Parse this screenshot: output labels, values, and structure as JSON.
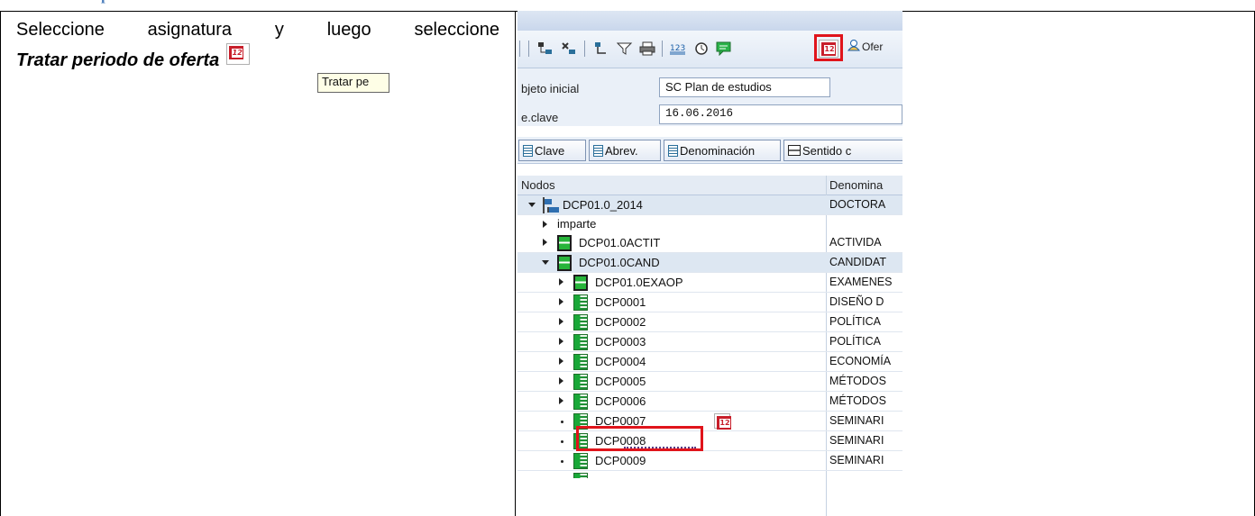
{
  "document": {
    "heading_fragment": "p",
    "instruction_line1_words": [
      "Seleccione",
      "asignatura",
      "y",
      "luego",
      "seleccione"
    ],
    "instruction_line2": "Tratar periodo de oferta",
    "instruction_icon": "offer-period-calendar-icon"
  },
  "sap": {
    "toolbar": {
      "icons": [
        "expand-icon",
        "collapse-icon",
        "filter-icon",
        "funnel-icon",
        "print-icon",
        "numbering-icon",
        "timer-icon",
        "comment-icon",
        "offer-period-calendar-icon",
        "person-icon"
      ],
      "ofer_label": "Ofer",
      "highlighted": "offer-period-calendar-icon"
    },
    "tooltip": "Tratar pe",
    "form": {
      "objeto_label": "bjeto inicial",
      "objeto_value": "SC Plan de estudios",
      "fecha_label": "e.clave",
      "fecha_value": "16.06.2016"
    },
    "buttons": [
      "Clave",
      "Abrev.",
      "Denominación",
      "Sentido c"
    ],
    "tree": {
      "col_nodes": "Nodos",
      "col_denom": "Denomina",
      "rows": [
        {
          "toggle": "down",
          "icon": "root",
          "label": "DCP01.0_2014",
          "denom": "DOCTORA"
        },
        {
          "toggle": "right",
          "icon": "",
          "label": "imparte",
          "denom": ""
        },
        {
          "toggle": "right",
          "icon": "mod",
          "label": "DCP01.0ACTIT",
          "denom": "ACTIVIDA"
        },
        {
          "toggle": "down",
          "icon": "mod",
          "label": "DCP01.0CAND",
          "denom": "CANDIDAT"
        },
        {
          "toggle": "right",
          "icon": "mod",
          "label": "DCP01.0EXAOP",
          "denom": "EXAMENES"
        },
        {
          "toggle": "right",
          "icon": "sub",
          "label": "DCP0001",
          "denom": "DISEÑO D"
        },
        {
          "toggle": "right",
          "icon": "sub",
          "label": "DCP0002",
          "denom": "POLÍTICA"
        },
        {
          "toggle": "right",
          "icon": "sub",
          "label": "DCP0003",
          "denom": "POLÍTICA"
        },
        {
          "toggle": "right",
          "icon": "sub",
          "label": "DCP0004",
          "denom": "ECONOMÍA"
        },
        {
          "toggle": "right",
          "icon": "sub",
          "label": "DCP0005",
          "denom": "MÉTODOS"
        },
        {
          "toggle": "right",
          "icon": "sub",
          "label": "DCP0006",
          "denom": "MÉTODOS"
        },
        {
          "toggle": "dot",
          "icon": "sub",
          "label": "DCP0007",
          "denom": "SEMINARI"
        },
        {
          "toggle": "dot",
          "icon": "sub",
          "label": "DCP0008",
          "denom": "SEMINARI"
        },
        {
          "toggle": "dot",
          "icon": "sub",
          "label": "DCP0009",
          "denom": "SEMINARI"
        }
      ]
    }
  },
  "colors": {
    "highlight": "#e0141b",
    "heading": "#4f81bd",
    "node_green": "#27b43a"
  }
}
